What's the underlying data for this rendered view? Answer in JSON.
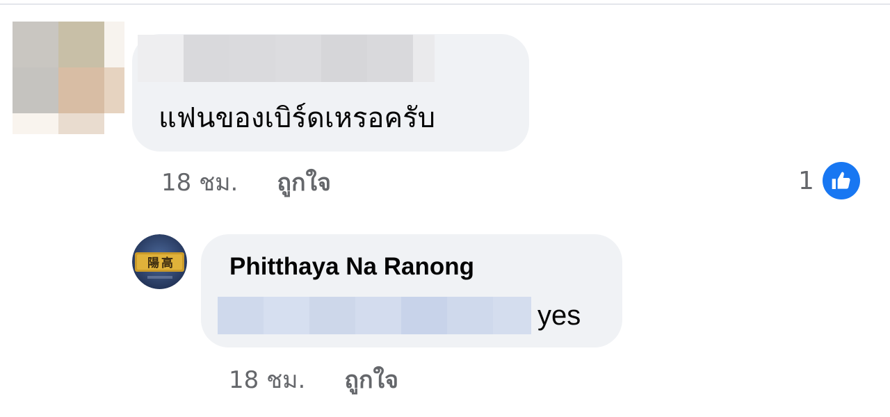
{
  "comments": [
    {
      "author_blurred": true,
      "text": "แฟนของเบิร์ดเหรอครับ",
      "timestamp": "18 ชม.",
      "like_label": "ถูกใจ",
      "reaction_count": "1",
      "reaction_icon": "thumbs-up-icon"
    },
    {
      "author": "Phitthaya Na Ranong",
      "mention_blurred": true,
      "text": "yes",
      "timestamp": "18 ชม.",
      "like_label": "ถูกใจ",
      "avatar_icon": "badge-avatar"
    }
  ],
  "colors": {
    "bubble": "#f0f2f5",
    "meta_text": "#65676b",
    "body_text": "#050505",
    "like_badge": "#1877f2",
    "mention_highlight": "#cfd9ec"
  }
}
